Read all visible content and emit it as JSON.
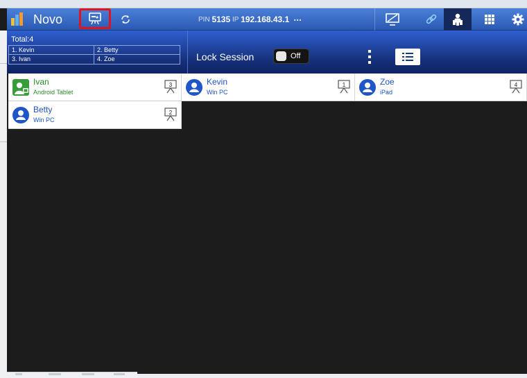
{
  "app": {
    "name": "Novo"
  },
  "toolbar": {
    "pin_prefix": "PIN",
    "pin": "5135",
    "ip_prefix": "IP",
    "ip": "192.168.43.1",
    "more": "..."
  },
  "session": {
    "total_label": "Total:4",
    "participants_order": [
      "1. Kevin",
      "2. Betty",
      "3. Ivan",
      "4. Zoe"
    ],
    "lock_label": "Lock Session",
    "lock_state": "Off"
  },
  "users": [
    {
      "name": "Ivan",
      "device": "Android Tablet",
      "slot": "3",
      "avatar_icon": "android-user-icon"
    },
    {
      "name": "Kevin",
      "device": "Win PC",
      "slot": "1",
      "avatar_icon": "user-avatar-icon"
    },
    {
      "name": "Zoe",
      "device": "iPad",
      "slot": "4",
      "avatar_icon": "user-avatar-icon"
    },
    {
      "name": "Betty",
      "device": "Win PC",
      "slot": "2",
      "avatar_icon": "user-avatar-icon"
    }
  ],
  "colors": {
    "toolbar": "#2f62c4",
    "header": "#16307a",
    "highlight": "#e0151b",
    "user_text": "#1f55c8",
    "android_text": "#2b8a2b",
    "canvas": "#1c1c1c"
  }
}
